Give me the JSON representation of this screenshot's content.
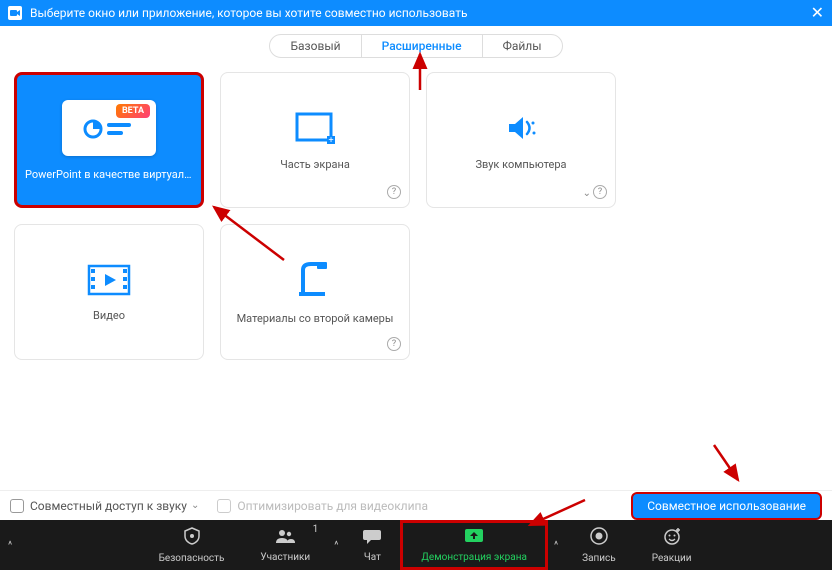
{
  "titlebar": {
    "title": "Выберите окно или приложение, которое вы хотите совместно использовать"
  },
  "tabs": {
    "basic": "Базовый",
    "advanced": "Расширенные",
    "files": "Файлы"
  },
  "cards": {
    "powerpoint": {
      "label": "PowerPoint в качестве виртуального ...",
      "badge": "BETA"
    },
    "portion": {
      "label": "Часть экрана"
    },
    "sound": {
      "label": "Звук компьютера"
    },
    "video": {
      "label": "Видео"
    },
    "camera2": {
      "label": "Материалы со второй камеры"
    }
  },
  "footer": {
    "share_audio": "Совместный доступ к звуку",
    "optimize": "Оптимизировать для видеоклипа",
    "share_btn": "Совместное использование"
  },
  "toolbar": {
    "security": "Безопасность",
    "participants": "Участники",
    "participants_count": "1",
    "chat": "Чат",
    "share_screen": "Демонстрация экрана",
    "record": "Запись",
    "reactions": "Реакции"
  }
}
